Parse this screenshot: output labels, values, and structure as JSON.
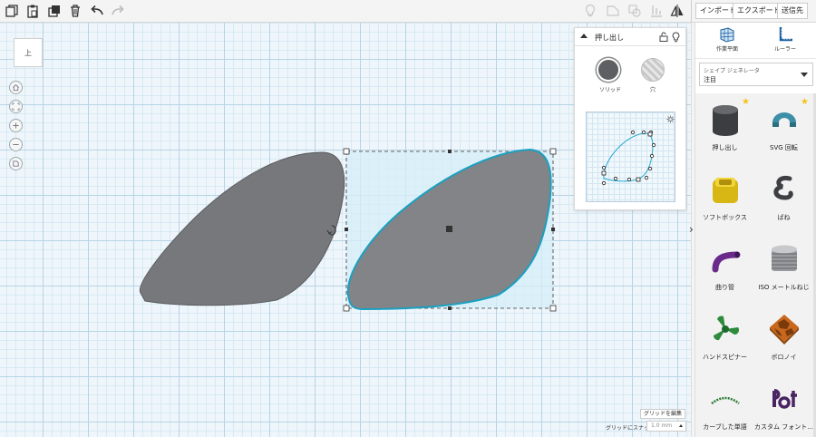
{
  "toolbar": {
    "left_icons": [
      "copy-icon",
      "paste-icon",
      "duplicate-icon",
      "trash-icon",
      "undo-icon",
      "redo-icon"
    ],
    "right_icons": [
      "bulb-icon",
      "hide-icon",
      "group-icon",
      "align-icon",
      "mirror-icon"
    ],
    "import_label": "インポート",
    "export_label": "エクスポート",
    "send_label": "送信先"
  },
  "viewcube": {
    "face_label": "上"
  },
  "nav_icons": [
    "home-icon",
    "fit-icon",
    "zoom-in-icon",
    "zoom-out-icon",
    "perspective-icon"
  ],
  "inspector": {
    "title": "押し出し",
    "solid_label": "ソリッド",
    "hole_label": "穴"
  },
  "panel": {
    "workplane_label": "作業平面",
    "ruler_label": "ルーラー",
    "generator_label": "シェイプ ジェネレータ",
    "generator_value": "注目",
    "shapes": [
      {
        "label": "押し出し",
        "starred": true,
        "icon": "extrude-shape-icon"
      },
      {
        "label": "SVG 回転",
        "starred": true,
        "icon": "svg-revolve-shape-icon"
      },
      {
        "label": "ソフトボックス",
        "starred": false,
        "icon": "soft-box-shape-icon"
      },
      {
        "label": "ばね",
        "starred": false,
        "icon": "spring-shape-icon"
      },
      {
        "label": "曲り管",
        "starred": false,
        "icon": "bent-pipe-shape-icon"
      },
      {
        "label": "ISO メートルねじ",
        "starred": false,
        "icon": "iso-screw-shape-icon"
      },
      {
        "label": "ハンドスピナー",
        "starred": false,
        "icon": "hand-spinner-shape-icon"
      },
      {
        "label": "ボロノイ",
        "starred": false,
        "icon": "voronoi-shape-icon"
      },
      {
        "label": "カーブした単語",
        "starred": false,
        "icon": "curved-text-shape-icon"
      },
      {
        "label": "カスタム フォント...",
        "starred": false,
        "icon": "custom-font-shape-icon"
      }
    ]
  },
  "footer": {
    "grid_edit_label": "グリッドを編集",
    "snap_label": "グリッドにスナップ",
    "snap_value": "1.0 mm"
  },
  "colors": {
    "shape_fill": "#7a7c7f",
    "selection": "#29a3c6",
    "accent": "#1a73c8"
  }
}
